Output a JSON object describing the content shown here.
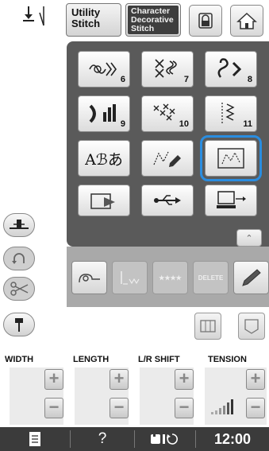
{
  "header": {
    "utility_tab": "Utility\nStitch",
    "character_tab": "Character\nDecorative\nStitch"
  },
  "panel": {
    "buttons": [
      {
        "name": "pattern-category-6",
        "number": "6"
      },
      {
        "name": "pattern-category-7",
        "number": "7"
      },
      {
        "name": "pattern-category-8",
        "number": "8"
      },
      {
        "name": "pattern-category-9",
        "number": "9"
      },
      {
        "name": "pattern-category-10",
        "number": "10"
      },
      {
        "name": "pattern-category-11",
        "number": "11"
      }
    ],
    "font_sample": "Aℬあ"
  },
  "lowpanel": {
    "delete_label": "DELETE",
    "stars_label": "★★★★"
  },
  "settings": {
    "width_label": "WIDTH",
    "length_label": "LENGTH",
    "lr_shift_label": "L/R SHIFT",
    "tension_label": "TENSION",
    "plus": "+",
    "minus": "−"
  },
  "bottombar": {
    "help": "?",
    "time": "12:00"
  },
  "colors": {
    "selected_outline": "#2a8de0",
    "panel_bg": "#5a5a5a",
    "bottom_bar": "#3b3b3b"
  }
}
